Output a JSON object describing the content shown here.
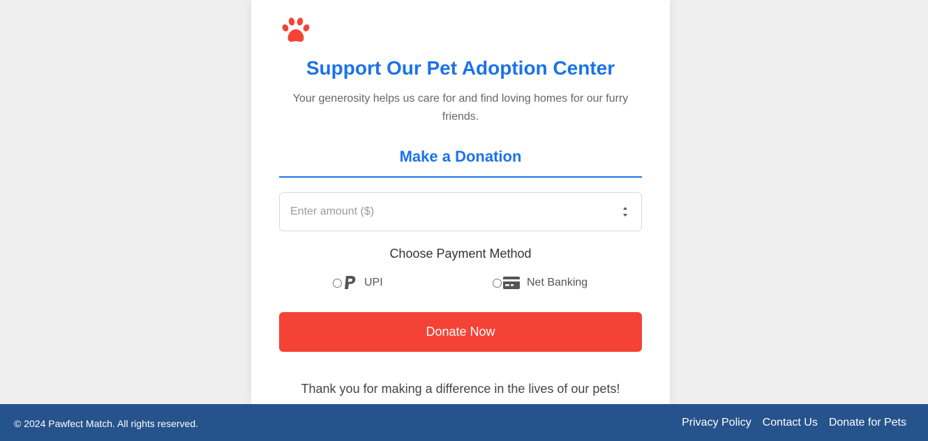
{
  "card": {
    "title": "Support Our Pet Adoption Center",
    "subtitle": "Your generosity helps us care for and find loving homes for our furry friends.",
    "section_title": "Make a Donation",
    "amount_placeholder": "Enter amount ($)",
    "amount_value": "",
    "payment_title": "Choose Payment Method",
    "payment_options": [
      {
        "label": "UPI",
        "icon": "paypal-icon",
        "selected": false
      },
      {
        "label": "Net Banking",
        "icon": "credit-card-icon",
        "selected": false
      }
    ],
    "donate_label": "Donate Now",
    "thanks": "Thank you for making a difference in the lives of our pets!"
  },
  "footer": {
    "copyright": "© 2024 Pawfect Match. All rights reserved.",
    "links": [
      "Privacy Policy",
      "Contact Us",
      "Donate for Pets"
    ]
  },
  "colors": {
    "accent": "#1a73e8",
    "donate_button": "#f44336",
    "paw_icon": "#f44336",
    "footer_bg": "#26538b",
    "page_bg": "#efefef"
  }
}
